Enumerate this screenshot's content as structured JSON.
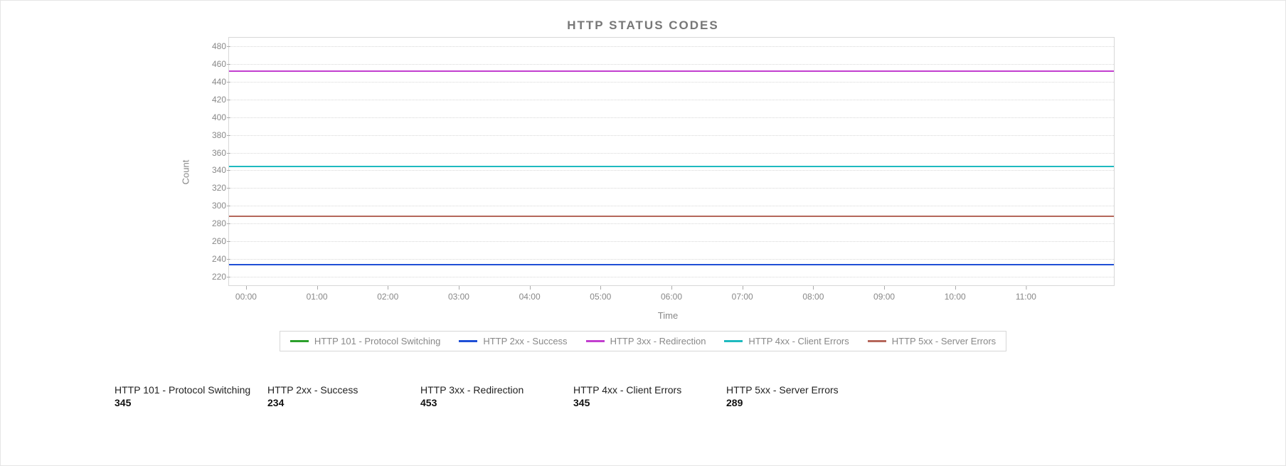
{
  "title": "HTTP STATUS CODES",
  "ylabel": "Count",
  "xlabel": "Time",
  "y_ticks": [
    220,
    240,
    260,
    280,
    300,
    320,
    340,
    360,
    380,
    400,
    420,
    440,
    460,
    480
  ],
  "x_ticks": [
    "00:00",
    "01:00",
    "02:00",
    "03:00",
    "04:00",
    "05:00",
    "06:00",
    "07:00",
    "08:00",
    "09:00",
    "10:00",
    "11:00"
  ],
  "series": [
    {
      "name": "HTTP 101 - Protocol Switching",
      "color": "#2ca02c",
      "value": 345
    },
    {
      "name": "HTTP 2xx - Success",
      "color": "#1f4fd6",
      "value": 234
    },
    {
      "name": "HTTP 3xx - Redirection",
      "color": "#c23fcf",
      "value": 453
    },
    {
      "name": "HTTP 4xx - Client Errors",
      "color": "#1fbabf",
      "value": 345
    },
    {
      "name": "HTTP 5xx - Server Errors",
      "color": "#b5675b",
      "value": 289
    }
  ],
  "ylim": [
    210,
    490
  ],
  "summary": [
    {
      "label": "HTTP 101 - Protocol Switching",
      "value": "345"
    },
    {
      "label": "HTTP 2xx - Success",
      "value": "234"
    },
    {
      "label": "HTTP 3xx - Redirection",
      "value": "453"
    },
    {
      "label": "HTTP 4xx - Client Errors",
      "value": "345"
    },
    {
      "label": "HTTP 5xx - Server Errors",
      "value": "289"
    }
  ],
  "chart_data": {
    "type": "line",
    "title": "HTTP STATUS CODES",
    "xlabel": "Time",
    "ylabel": "Count",
    "ylim": [
      210,
      490
    ],
    "categories": [
      "00:00",
      "01:00",
      "02:00",
      "03:00",
      "04:00",
      "05:00",
      "06:00",
      "07:00",
      "08:00",
      "09:00",
      "10:00",
      "11:00"
    ],
    "series": [
      {
        "name": "HTTP 101 - Protocol Switching",
        "values": [
          345,
          345,
          345,
          345,
          345,
          345,
          345,
          345,
          345,
          345,
          345,
          345
        ]
      },
      {
        "name": "HTTP 2xx - Success",
        "values": [
          234,
          234,
          234,
          234,
          234,
          234,
          234,
          234,
          234,
          234,
          234,
          234
        ]
      },
      {
        "name": "HTTP 3xx - Redirection",
        "values": [
          453,
          453,
          453,
          453,
          453,
          453,
          453,
          453,
          453,
          453,
          453,
          453
        ]
      },
      {
        "name": "HTTP 4xx - Client Errors",
        "values": [
          345,
          345,
          345,
          345,
          345,
          345,
          345,
          345,
          345,
          345,
          345,
          345
        ]
      },
      {
        "name": "HTTP 5xx - Server Errors",
        "values": [
          289,
          289,
          289,
          289,
          289,
          289,
          289,
          289,
          289,
          289,
          289,
          289
        ]
      }
    ]
  }
}
